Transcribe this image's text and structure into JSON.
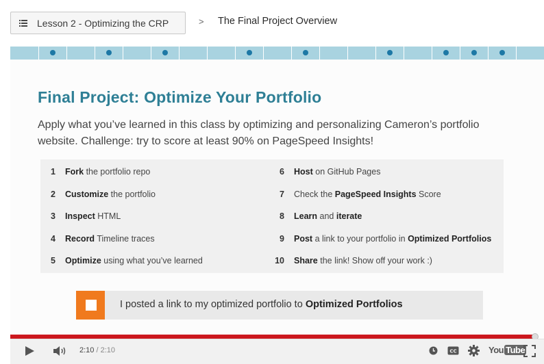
{
  "breadcrumb": {
    "lesson_label": "Lesson 2 - Optimizing the CRP",
    "separator": ">",
    "current": "The Final Project Overview"
  },
  "progress_strip": {
    "total_segments": 19,
    "segments_with_dots": [
      1,
      3,
      5,
      8,
      10,
      13,
      15,
      16,
      17
    ]
  },
  "slide": {
    "title": "Final Project: Optimize Your Portfolio",
    "description": "Apply what you’ve learned in this class by optimizing and personalizing Cameron’s portfolio website. Challenge: try to score at least 90% on PageSpeed Insights!",
    "steps_left": [
      {
        "num": "1",
        "parts": [
          {
            "t": "Fork",
            "b": true
          },
          {
            "t": " the portfolio repo",
            "b": false
          }
        ]
      },
      {
        "num": "2",
        "parts": [
          {
            "t": "Customize",
            "b": true
          },
          {
            "t": " the portfolio",
            "b": false
          }
        ]
      },
      {
        "num": "3",
        "parts": [
          {
            "t": "Inspect",
            "b": true
          },
          {
            "t": " HTML",
            "b": false
          }
        ]
      },
      {
        "num": "4",
        "parts": [
          {
            "t": "Record",
            "b": true
          },
          {
            "t": " Timeline traces",
            "b": false
          }
        ]
      },
      {
        "num": "5",
        "parts": [
          {
            "t": "Optimize",
            "b": true
          },
          {
            "t": " using what you’ve learned",
            "b": false
          }
        ]
      }
    ],
    "steps_right": [
      {
        "num": "6",
        "parts": [
          {
            "t": "Host",
            "b": true
          },
          {
            "t": " on GitHub Pages",
            "b": false
          }
        ]
      },
      {
        "num": "7",
        "parts": [
          {
            "t": "Check the ",
            "b": false
          },
          {
            "t": "PageSpeed Insights",
            "b": true
          },
          {
            "t": " Score",
            "b": false
          }
        ]
      },
      {
        "num": "8",
        "parts": [
          {
            "t": "Learn",
            "b": true
          },
          {
            "t": " and ",
            "b": false
          },
          {
            "t": "iterate",
            "b": true
          }
        ]
      },
      {
        "num": "9",
        "parts": [
          {
            "t": "Post",
            "b": true
          },
          {
            "t": " a link to your portfolio in ",
            "b": false
          },
          {
            "t": "Optimized Portfolios",
            "b": true
          }
        ]
      },
      {
        "num": "10",
        "parts": [
          {
            "t": "Share",
            "b": true
          },
          {
            "t": " the link! Show off your work :)",
            "b": false
          }
        ]
      }
    ],
    "checklist_item": {
      "text": "I posted a link to my optimized portfolio to ",
      "bold": "Optimized Portfolios",
      "checked": false
    }
  },
  "player": {
    "current_time": "2:10",
    "separator": " / ",
    "duration": "2:10",
    "progress_fraction": 1.0,
    "logo_you": "You",
    "logo_tube": "Tube",
    "icons": [
      "play-icon",
      "volume-icon",
      "watch-later-icon",
      "captions-icon",
      "settings-icon",
      "fullscreen-icon"
    ]
  },
  "colors": {
    "title": "#2e7f95",
    "strip": "#a9d3e0",
    "strip_dot": "#1d78a5",
    "checkbox": "#f07a1e",
    "progress": "#cc181e"
  }
}
